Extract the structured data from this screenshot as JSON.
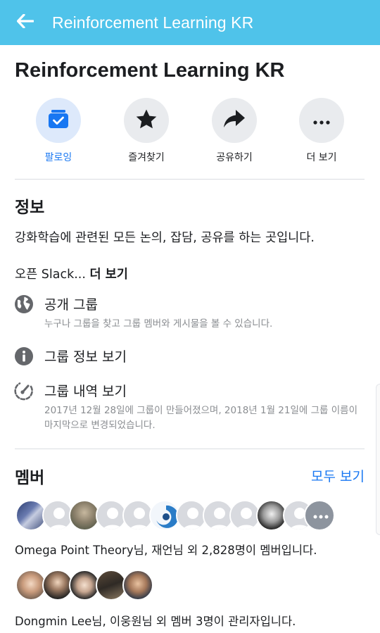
{
  "header": {
    "title": "Reinforcement Learning KR",
    "back_icon": "arrow-left-icon",
    "bg_color": "#4fc3ea"
  },
  "group": {
    "name": "Reinforcement Learning KR"
  },
  "actions": [
    {
      "label": "팔로잉",
      "icon": "following-check-icon",
      "active": true
    },
    {
      "label": "즐겨찾기",
      "icon": "star-icon",
      "active": false
    },
    {
      "label": "공유하기",
      "icon": "share-arrow-icon",
      "active": false
    },
    {
      "label": "더 보기",
      "icon": "more-dots-icon",
      "active": false
    }
  ],
  "about": {
    "title": "정보",
    "description": "강화학습에 관련된 모든 논의, 잡담, 공유를 하는 곳입니다.",
    "slack_text": "오픈 Slack...",
    "slack_more": "더 보기",
    "privacy": {
      "title": "공개 그룹",
      "subtitle": "누구나 그룹을 찾고 그룹 멤버와 게시물을 볼 수 있습니다.",
      "icon": "globe-icon"
    },
    "group_info": {
      "title": "그룹 정보 보기",
      "icon": "info-icon"
    },
    "history": {
      "title": "그룹 내역 보기",
      "subtitle": "2017년 12월 28일에 그룹이 만들어졌으며, 2018년 1월 21일에 그룹 이름이 마지막으로 변경되었습니다.",
      "icon": "history-icon"
    }
  },
  "members": {
    "title": "멤버",
    "see_all": "모두 보기",
    "summary": "Omega Point Theory님, 재언님 외 2,828명이 멤버입니다.",
    "admins_summary": "Dongmin Lee님, 이웅원님 외 멤버 3명이 관리자입니다."
  },
  "accent_color": "#1877f2"
}
